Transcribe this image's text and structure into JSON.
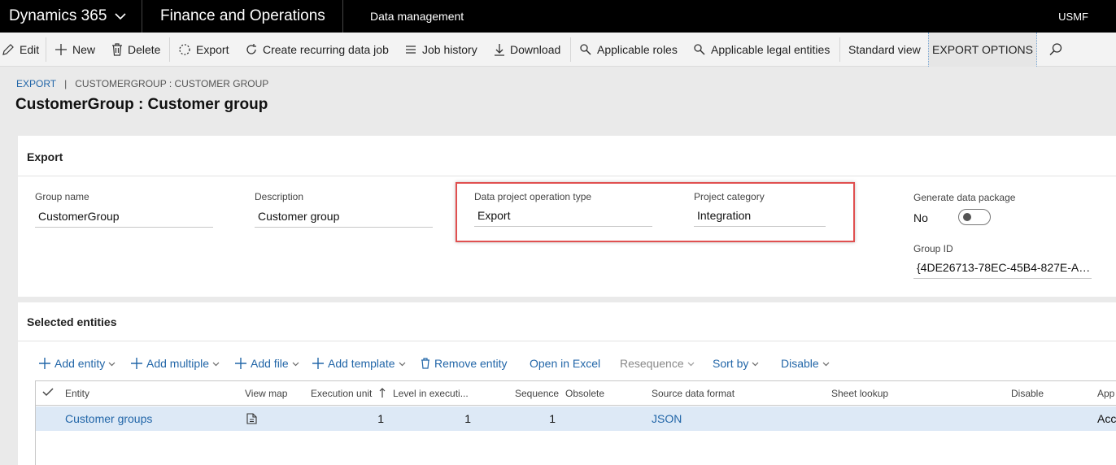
{
  "navbar": {
    "app_name": "Dynamics 365",
    "module": "Finance and Operations",
    "area": "Data management",
    "company": "USMF"
  },
  "actions": {
    "edit": "Edit",
    "new": "New",
    "delete": "Delete",
    "export": "Export",
    "recurring": "Create recurring data job",
    "job_history": "Job history",
    "download": "Download",
    "applicable_roles": "Applicable roles",
    "applicable_legal_entities": "Applicable legal entities",
    "standard_view": "Standard view",
    "export_options": "EXPORT OPTIONS"
  },
  "breadcrumb": {
    "root": "EXPORT",
    "separator": "|",
    "current": "CUSTOMERGROUP : CUSTOMER GROUP"
  },
  "page_title": "CustomerGroup : Customer group",
  "export_section": {
    "header": "Export",
    "group_name_label": "Group name",
    "group_name_value": "CustomerGroup",
    "description_label": "Description",
    "description_value": "Customer group",
    "operation_type_label": "Data project operation type",
    "operation_type_value": "Export",
    "project_category_label": "Project category",
    "project_category_value": "Integration",
    "generate_package_label": "Generate data package",
    "generate_package_value": "No",
    "generate_package_on": false,
    "group_id_label": "Group ID",
    "group_id_value": "{4DE26713-78EC-45B4-827E-AD..."
  },
  "entities_section": {
    "header": "Selected entities",
    "toolbar": {
      "add_entity": "Add entity",
      "add_multiple": "Add multiple",
      "add_file": "Add file",
      "add_template": "Add template",
      "remove_entity": "Remove entity",
      "open_in_excel": "Open in Excel",
      "resequence": "Resequence",
      "sort_by": "Sort by",
      "disable": "Disable"
    },
    "columns": {
      "entity": "Entity",
      "view_map": "View map",
      "execution_unit": "Execution unit",
      "level_in_execution": "Level in executi...",
      "sequence": "Sequence",
      "obsolete": "Obsolete",
      "source_data_format": "Source data format",
      "sheet_lookup": "Sheet lookup",
      "disable": "Disable",
      "app": "App"
    },
    "rows": [
      {
        "entity": "Customer groups",
        "execution_unit": "1",
        "level_in_execution": "1",
        "sequence": "1",
        "source_data_format": "JSON",
        "app": "Acc"
      }
    ]
  },
  "colors": {
    "navbar_bg": "#000000",
    "link": "#2266a8",
    "highlight_border": "#e05050",
    "selected_row": "#dde9f6"
  }
}
